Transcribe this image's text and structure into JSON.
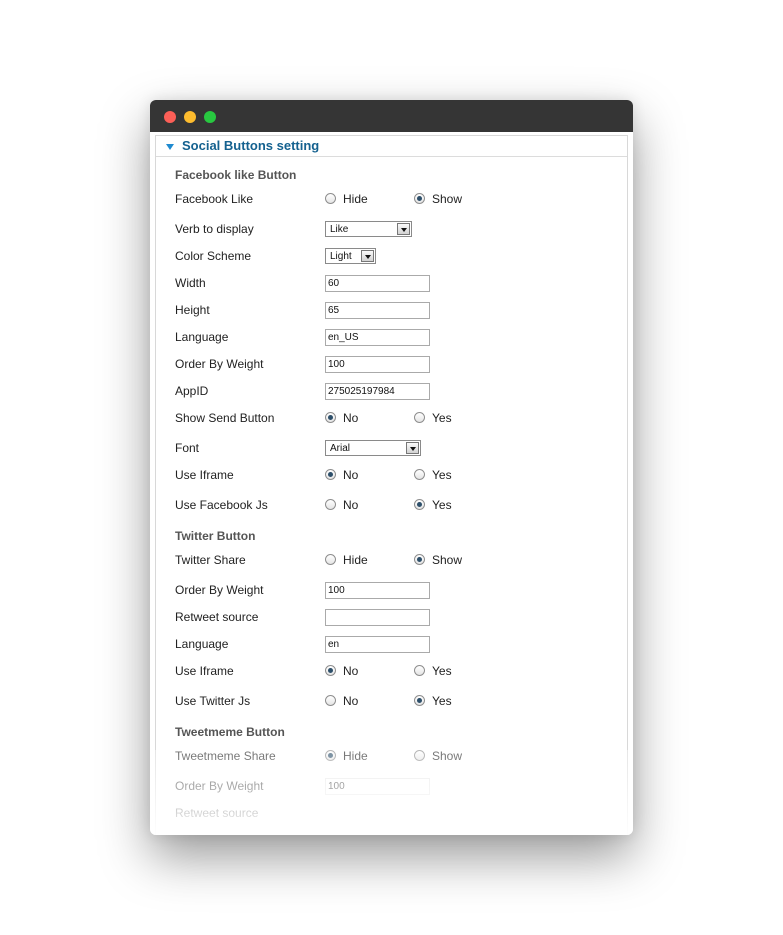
{
  "panel": {
    "title": "Social Buttons setting"
  },
  "facebook": {
    "section_title": "Facebook like Button",
    "facebook_like": {
      "label": "Facebook Like",
      "opt1": "Hide",
      "opt2": "Show",
      "selected": "Show"
    },
    "verb": {
      "label": "Verb to display",
      "value": "Like"
    },
    "color_scheme": {
      "label": "Color Scheme",
      "value": "Light"
    },
    "width": {
      "label": "Width",
      "value": "60"
    },
    "height": {
      "label": "Height",
      "value": "65"
    },
    "language": {
      "label": "Language",
      "value": "en_US"
    },
    "order": {
      "label": "Order By Weight",
      "value": "100"
    },
    "appid": {
      "label": "AppID",
      "value": "275025197984"
    },
    "send_button": {
      "label": "Show Send Button",
      "opt1": "No",
      "opt2": "Yes",
      "selected": "No"
    },
    "font": {
      "label": "Font",
      "value": "Arial"
    },
    "iframe": {
      "label": "Use Iframe",
      "opt1": "No",
      "opt2": "Yes",
      "selected": "No"
    },
    "fb_js": {
      "label": "Use Facebook Js",
      "opt1": "No",
      "opt2": "Yes",
      "selected": "Yes"
    }
  },
  "twitter": {
    "section_title": "Twitter Button",
    "share": {
      "label": "Twitter Share",
      "opt1": "Hide",
      "opt2": "Show",
      "selected": "Show"
    },
    "order": {
      "label": "Order By Weight",
      "value": "100"
    },
    "retweet": {
      "label": "Retweet source",
      "value": ""
    },
    "language": {
      "label": "Language",
      "value": "en"
    },
    "iframe": {
      "label": "Use Iframe",
      "opt1": "No",
      "opt2": "Yes",
      "selected": "No"
    },
    "tw_js": {
      "label": "Use Twitter Js",
      "opt1": "No",
      "opt2": "Yes",
      "selected": "Yes"
    }
  },
  "tweetmeme": {
    "section_title": "Tweetmeme Button",
    "share": {
      "label": "Tweetmeme Share",
      "opt1": "Hide",
      "opt2": "Show",
      "selected": "Hide"
    },
    "order": {
      "label": "Order By Weight",
      "value": "100"
    },
    "retweet": {
      "label": "Retweet source"
    }
  }
}
